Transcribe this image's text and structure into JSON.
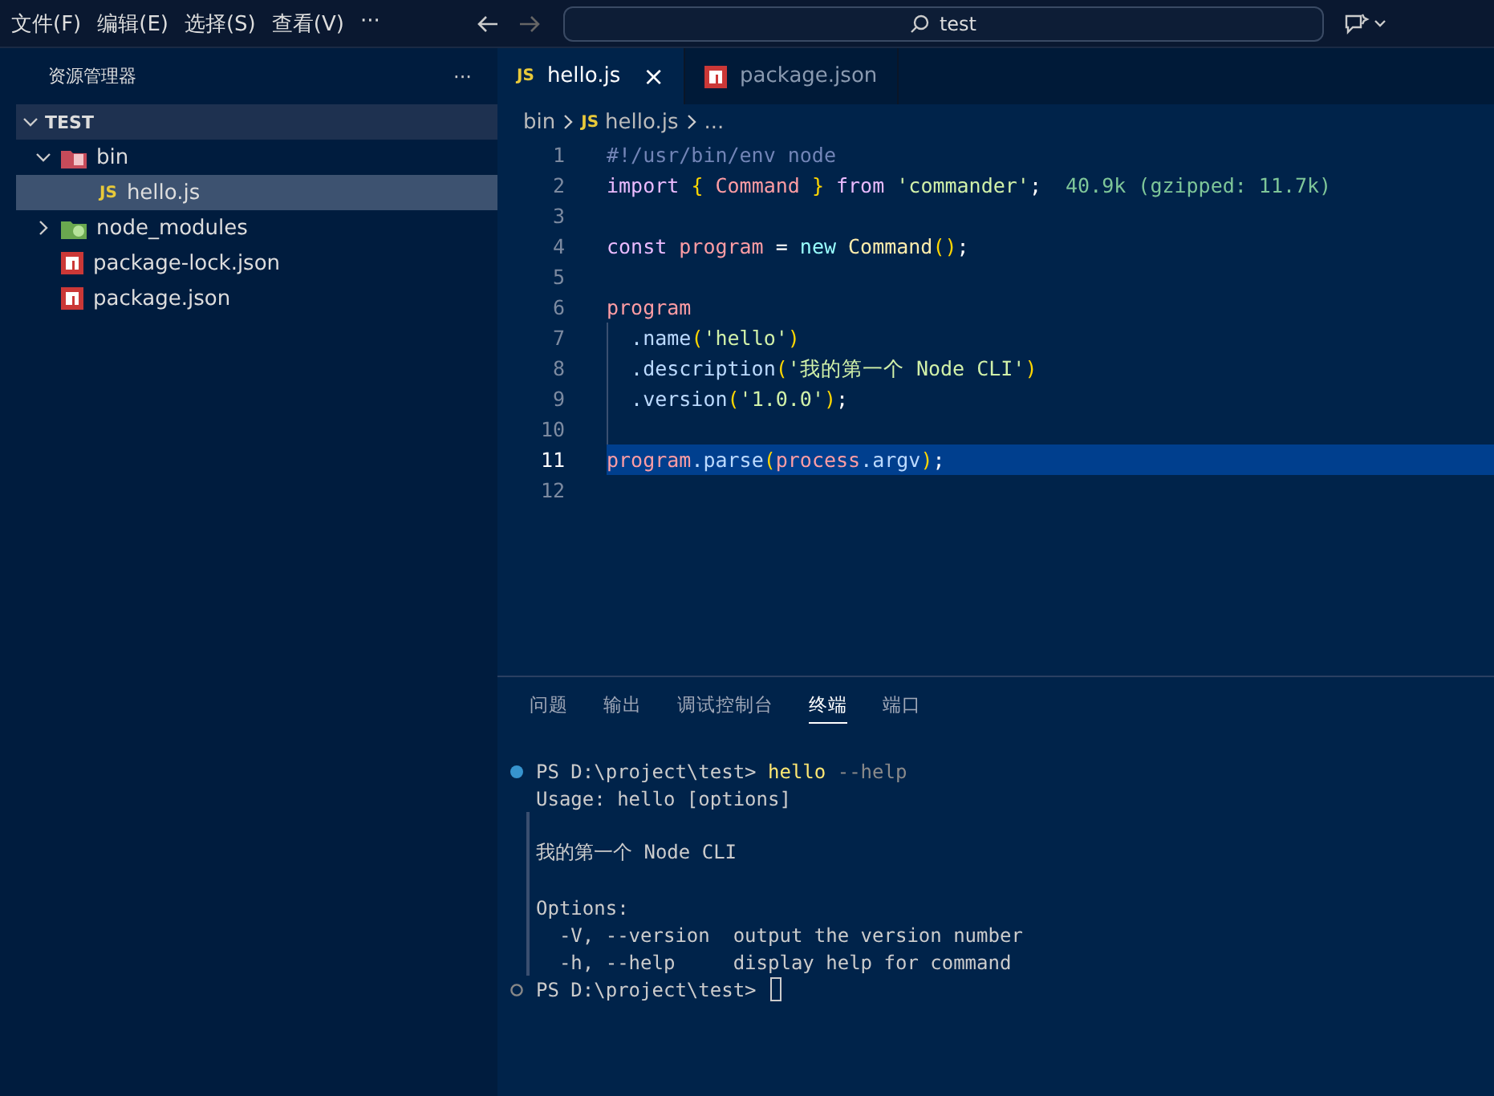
{
  "menu": [
    "文件(F)",
    "编辑(E)",
    "选择(S)",
    "查看(V)",
    "···"
  ],
  "search": {
    "value": "test"
  },
  "sidebar": {
    "title": "资源管理器",
    "more": "···",
    "section": {
      "label": "TEST",
      "expanded": true
    },
    "tree": [
      {
        "label": "bin",
        "kind": "folder",
        "expanded": true,
        "selected": false,
        "children": [
          {
            "label": "hello.js",
            "kind": "js",
            "icon_text": "JS",
            "selected": true
          }
        ]
      },
      {
        "label": "node_modules",
        "kind": "modules",
        "expanded": false,
        "selected": false
      },
      {
        "label": "package-lock.json",
        "kind": "npm",
        "selected": false
      },
      {
        "label": "package.json",
        "kind": "npm",
        "selected": false
      }
    ]
  },
  "tabs": [
    {
      "label": "hello.js",
      "kind": "js",
      "icon_text": "JS",
      "selected": true,
      "close": "×"
    },
    {
      "label": "package.json",
      "kind": "npm",
      "selected": false
    }
  ],
  "breadcrumb": [
    {
      "label": "bin",
      "kind": "text"
    },
    {
      "label": "hello.js",
      "kind": "js",
      "icon_text": "JS"
    },
    {
      "label": "...",
      "kind": "text"
    }
  ],
  "code": [
    {
      "number": "1",
      "current": false,
      "guide": false,
      "tokens": [
        {
          "t": "#!/usr/bin/env node",
          "kind": "comment"
        }
      ]
    },
    {
      "number": "2",
      "current": false,
      "guide": false,
      "tokens": [
        {
          "t": "import ",
          "kind": "keyword"
        },
        {
          "t": "{",
          "kind": "brace"
        },
        {
          "t": " Command ",
          "kind": "variable"
        },
        {
          "t": "}",
          "kind": "brace"
        },
        {
          "t": " from ",
          "kind": "keyword"
        },
        {
          "t": "'commander'",
          "kind": "string"
        },
        {
          "t": ";",
          "kind": "plain"
        },
        {
          "t": "  40.9k (gzipped: 11.7k)",
          "kind": "inlay"
        }
      ]
    },
    {
      "number": "3",
      "current": false,
      "guide": false
    },
    {
      "number": "4",
      "current": false,
      "guide": false,
      "tokens": [
        {
          "t": "const ",
          "kind": "keyword"
        },
        {
          "t": "program",
          "kind": "variable"
        },
        {
          "t": " = ",
          "kind": "plain"
        },
        {
          "t": "new ",
          "kind": "operator"
        },
        {
          "t": "Command",
          "kind": "class"
        },
        {
          "t": "()",
          "kind": "brace"
        },
        {
          "t": ";",
          "kind": "plain"
        }
      ]
    },
    {
      "number": "5",
      "current": false,
      "guide": false
    },
    {
      "number": "6",
      "current": false,
      "guide": false,
      "tokens": [
        {
          "t": "program",
          "kind": "variable"
        }
      ]
    },
    {
      "number": "7",
      "current": false,
      "guide": true,
      "tokens": [
        {
          "t": "  .name",
          "kind": "method"
        },
        {
          "t": "(",
          "kind": "brace"
        },
        {
          "t": "'hello'",
          "kind": "string"
        },
        {
          "t": ")",
          "kind": "brace"
        }
      ]
    },
    {
      "number": "8",
      "current": false,
      "guide": true,
      "tokens": [
        {
          "t": "  .description",
          "kind": "method"
        },
        {
          "t": "(",
          "kind": "brace"
        },
        {
          "t": "'我的第一个 Node CLI'",
          "kind": "string"
        },
        {
          "t": ")",
          "kind": "brace"
        }
      ]
    },
    {
      "number": "9",
      "current": false,
      "guide": true,
      "tokens": [
        {
          "t": "  .version",
          "kind": "method"
        },
        {
          "t": "(",
          "kind": "brace"
        },
        {
          "t": "'1.0.0'",
          "kind": "string"
        },
        {
          "t": ")",
          "kind": "brace"
        },
        {
          "t": ";",
          "kind": "plain"
        }
      ]
    },
    {
      "number": "10",
      "current": false,
      "guide": true
    },
    {
      "number": "11",
      "current": true,
      "guide": false,
      "tokens": [
        {
          "t": "program",
          "kind": "variable"
        },
        {
          "t": ".parse",
          "kind": "method"
        },
        {
          "t": "(",
          "kind": "brace"
        },
        {
          "t": "process",
          "kind": "variable"
        },
        {
          "t": ".argv",
          "kind": "method"
        },
        {
          "t": ")",
          "kind": "brace"
        },
        {
          "t": ";",
          "kind": "plain"
        }
      ]
    },
    {
      "number": "12",
      "current": false,
      "guide": false
    }
  ],
  "panel_tabs": [
    {
      "label": "问题",
      "selected": false
    },
    {
      "label": "输出",
      "selected": false
    },
    {
      "label": "调试控制台",
      "selected": false
    },
    {
      "label": "终端",
      "selected": true
    },
    {
      "label": "端口",
      "selected": false
    }
  ],
  "terminal": [
    {
      "completed": true,
      "bar": false,
      "segments": [
        {
          "t": "PS D:\\project\\test> ",
          "kind": "output"
        },
        {
          "t": "hello",
          "kind": "command"
        },
        {
          "t": " --help",
          "kind": "argument"
        }
      ]
    },
    {
      "bar": false,
      "segments": [
        {
          "t": "Usage: hello [options]",
          "kind": "output"
        }
      ]
    },
    {
      "bar": true
    },
    {
      "bar": true,
      "segments": [
        {
          "t": "我的第一个 Node CLI",
          "kind": "output"
        }
      ]
    },
    {
      "bar": true
    },
    {
      "bar": true,
      "segments": [
        {
          "t": "Options:",
          "kind": "output"
        }
      ]
    },
    {
      "bar": true,
      "segments": [
        {
          "t": "  -V, --version  output the version number",
          "kind": "output"
        }
      ]
    },
    {
      "bar": true,
      "segments": [
        {
          "t": "  -h, --help     display help for command",
          "kind": "output"
        }
      ]
    },
    {
      "completed": false,
      "bar": false,
      "cursor": true,
      "segments": [
        {
          "t": "PS D:\\project\\test> ",
          "kind": "output"
        }
      ]
    }
  ]
}
